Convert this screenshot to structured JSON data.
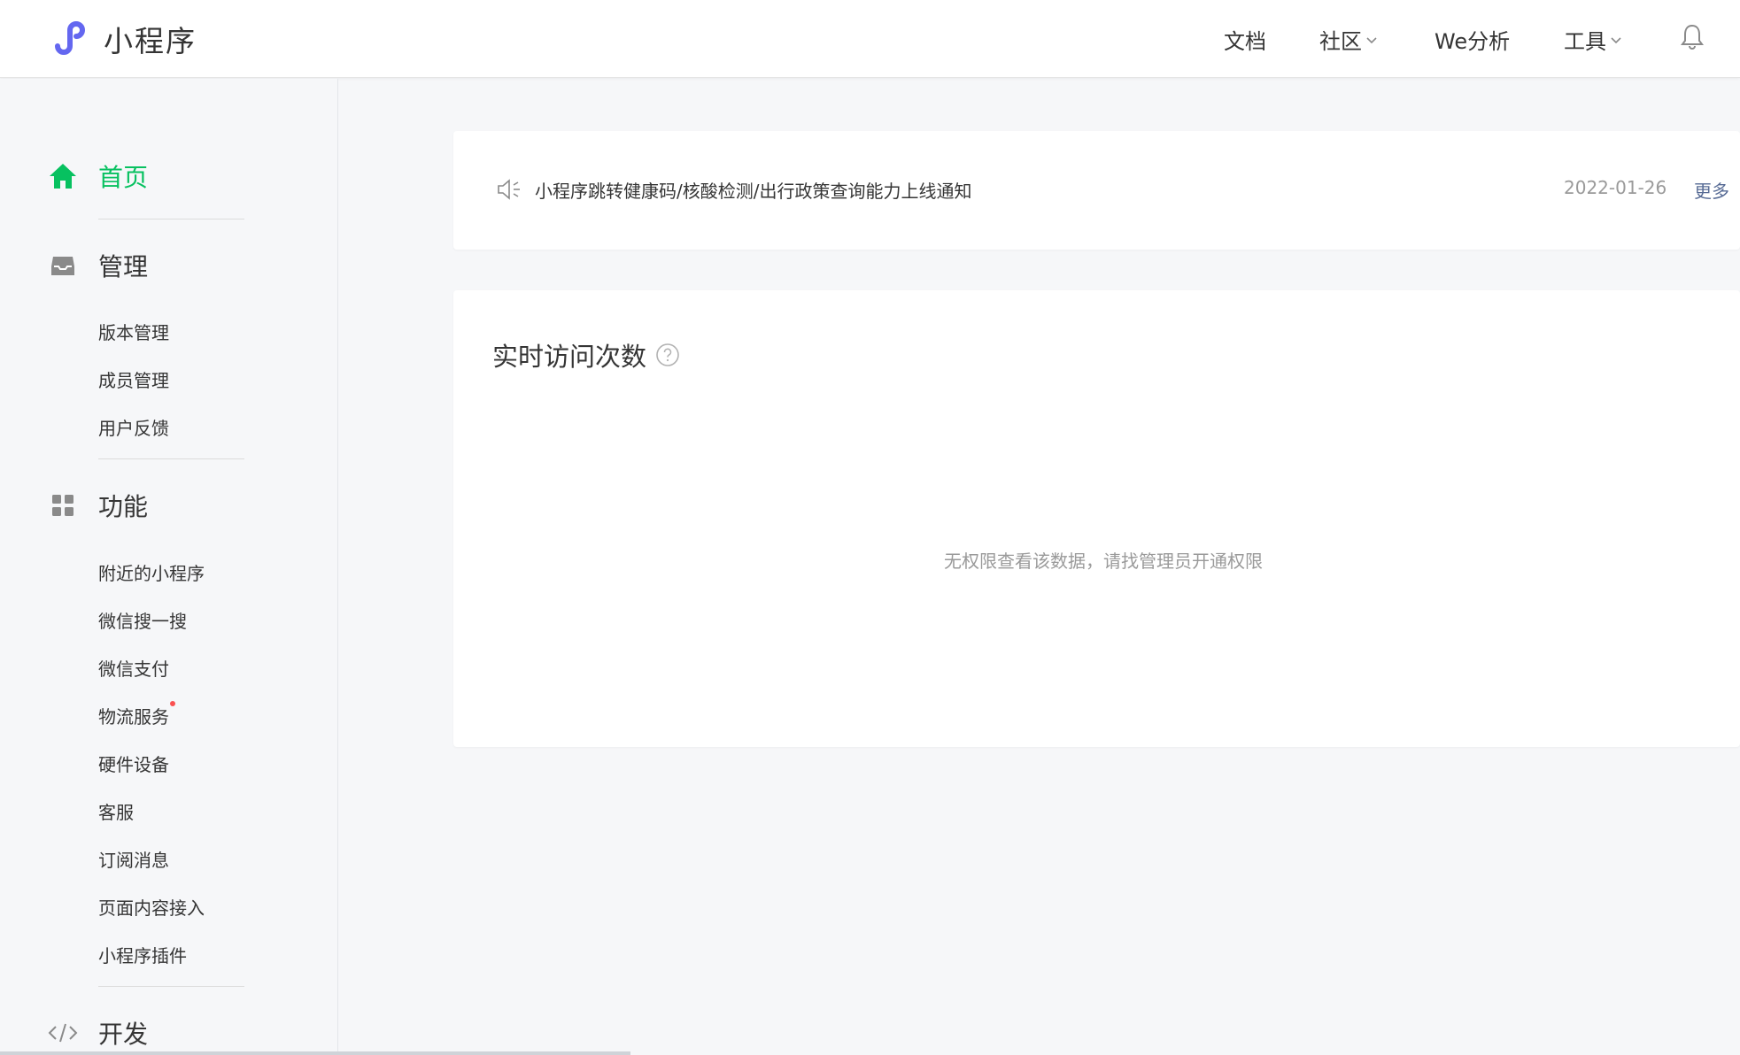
{
  "app": {
    "title": "小程序",
    "brand_color": "#6467f0",
    "accent_color": "#07c160",
    "link_color": "#576b95"
  },
  "topnav": {
    "docs": "文档",
    "community": "社区",
    "we_analytics": "We分析",
    "tools": "工具",
    "bell_icon": "bell-icon"
  },
  "sidebar": {
    "home": {
      "label": "首页",
      "icon": "home-icon"
    },
    "manage": {
      "label": "管理",
      "icon": "inbox-icon",
      "items": [
        "版本管理",
        "成员管理",
        "用户反馈"
      ]
    },
    "features": {
      "label": "功能",
      "icon": "grid-icon",
      "items": [
        "附近的小程序",
        "微信搜一搜",
        "微信支付",
        "物流服务",
        "硬件设备",
        "客服",
        "订阅消息",
        "页面内容接入",
        "小程序插件"
      ]
    },
    "develop": {
      "label": "开发",
      "icon": "code-icon"
    }
  },
  "notice": {
    "icon": "speaker-icon",
    "text": "小程序跳转健康码/核酸检测/出行政策查询能力上线通知",
    "date": "2022-01-26",
    "more": "更多"
  },
  "visits": {
    "title": "实时访问次数",
    "help_icon": "question-icon",
    "message": "无权限查看该数据，请找管理员开通权限"
  }
}
